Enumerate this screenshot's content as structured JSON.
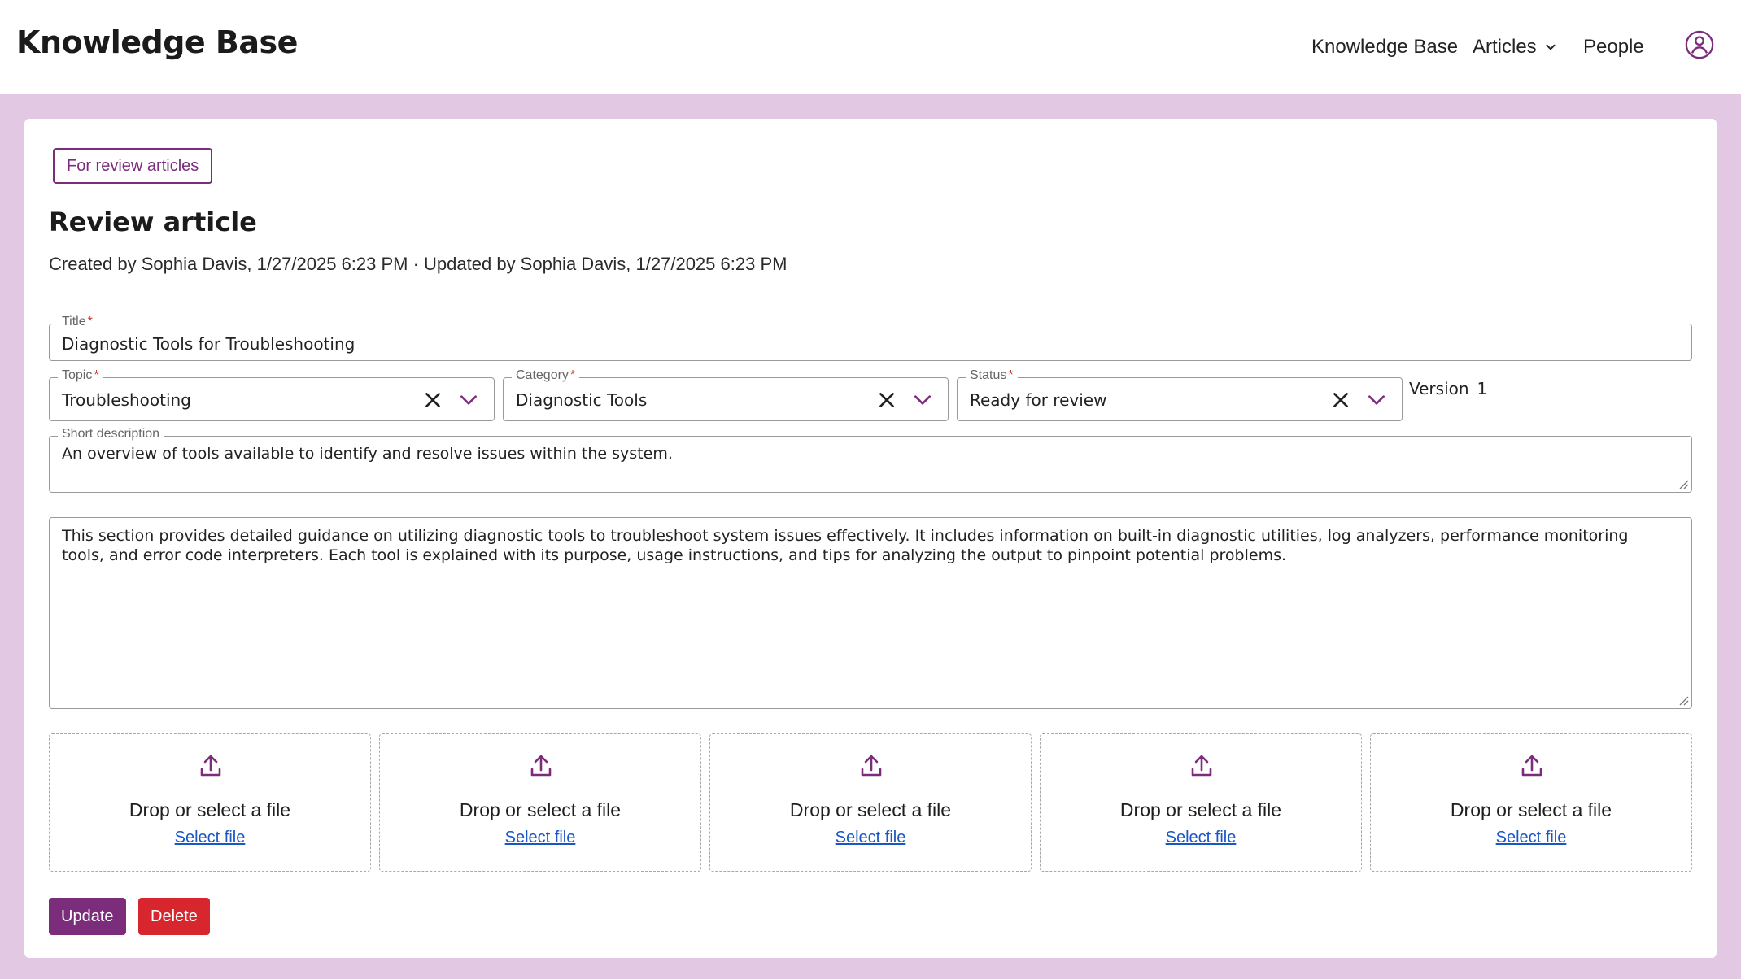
{
  "header": {
    "brand": "Knowledge Base",
    "nav": {
      "knowledge_base": "Knowledge Base",
      "articles": "Articles",
      "people": "People"
    },
    "avatar_icon": "user-circle-icon"
  },
  "page": {
    "back_button": "For review articles",
    "title": "Review article",
    "meta": "Created by Sophia Davis, 1/27/2025 6:23 PM · Updated by Sophia Davis, 1/27/2025 6:23 PM"
  },
  "form": {
    "title": {
      "label": "Title",
      "required": "*",
      "value": "Diagnostic Tools for Troubleshooting"
    },
    "topic": {
      "label": "Topic",
      "required": "*",
      "value": "Troubleshooting"
    },
    "category": {
      "label": "Category",
      "required": "*",
      "value": "Diagnostic Tools"
    },
    "status": {
      "label": "Status",
      "required": "*",
      "value": "Ready for review"
    },
    "version": {
      "label": "Version",
      "value": "1"
    },
    "short_description": {
      "label": "Short description",
      "value": "An overview of tools available to identify and resolve issues within the system."
    },
    "body": {
      "value": "This section provides detailed guidance on utilizing diagnostic tools to troubleshoot system issues effectively. It includes information on built-in diagnostic utilities, log analyzers, performance monitoring tools, and error code interpreters. Each tool is explained with its purpose, usage instructions, and tips for analyzing the output to pinpoint potential problems."
    }
  },
  "dropzones": [
    {
      "text": "Drop or select a file",
      "link": "Select file"
    },
    {
      "text": "Drop or select a file",
      "link": "Select file"
    },
    {
      "text": "Drop or select a file",
      "link": "Select file"
    },
    {
      "text": "Drop or select a file",
      "link": "Select file"
    },
    {
      "text": "Drop or select a file",
      "link": "Select file"
    }
  ],
  "actions": {
    "update": "Update",
    "delete": "Delete"
  },
  "colors": {
    "accent": "#7b2c7b",
    "danger": "#d7262d",
    "page_background": "#e2c8e2",
    "link": "#1a56c4"
  }
}
